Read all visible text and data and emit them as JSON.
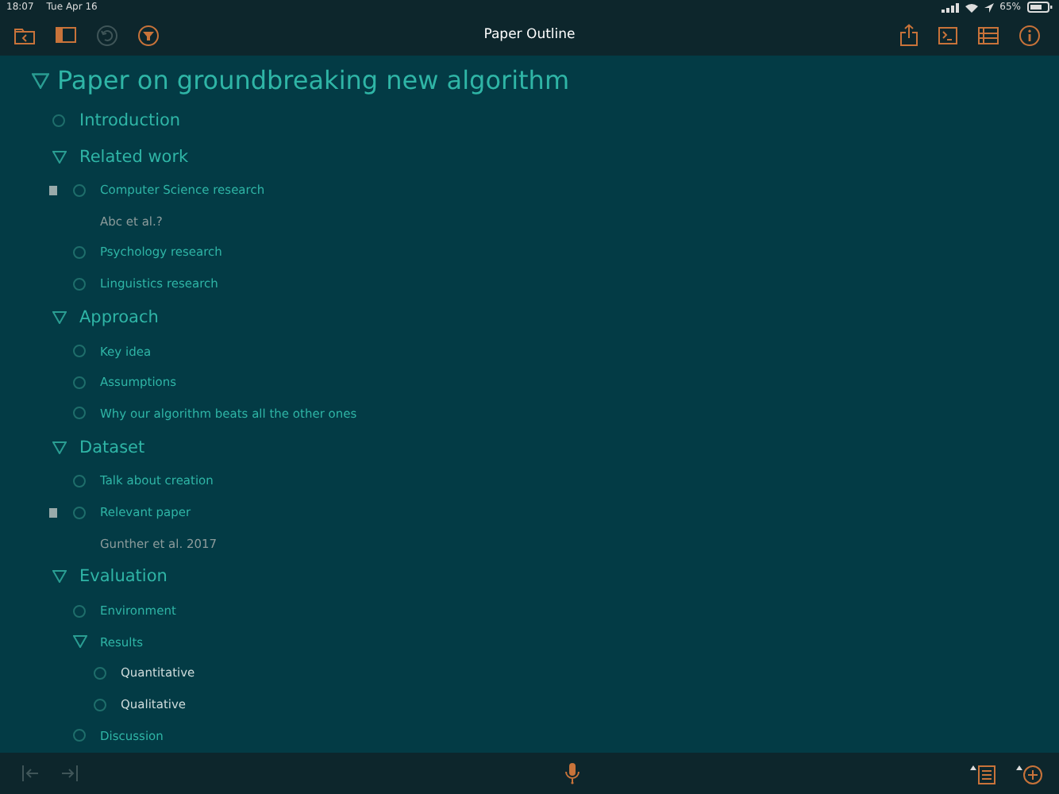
{
  "status_bar": {
    "time": "18:07",
    "date": "Tue Apr 16",
    "battery": "65%"
  },
  "toolbar": {
    "title": "Paper Outline"
  },
  "outline": [
    {
      "title": "Paper on groundbreaking new algorithm",
      "expanded": true,
      "children": [
        {
          "title": "Introduction"
        },
        {
          "title": "Related work",
          "expanded": true,
          "children": [
            {
              "title": "Computer Science research",
              "note": "Abc et al.?"
            },
            {
              "title": "Psychology research"
            },
            {
              "title": "Linguistics research"
            }
          ]
        },
        {
          "title": "Approach",
          "expanded": true,
          "children": [
            {
              "title": "Key idea"
            },
            {
              "title": "Assumptions"
            },
            {
              "title": "Why our algorithm beats all the other ones"
            }
          ]
        },
        {
          "title": "Dataset",
          "expanded": true,
          "children": [
            {
              "title": "Talk about creation"
            },
            {
              "title": "Relevant paper",
              "note": "Gunther et al. 2017"
            }
          ]
        },
        {
          "title": "Evaluation",
          "expanded": true,
          "children": [
            {
              "title": "Environment"
            },
            {
              "title": "Results",
              "expanded": true,
              "children": [
                {
                  "title": "Quantitative"
                },
                {
                  "title": "Qualitative"
                }
              ]
            },
            {
              "title": "Discussion"
            }
          ]
        }
      ]
    }
  ]
}
